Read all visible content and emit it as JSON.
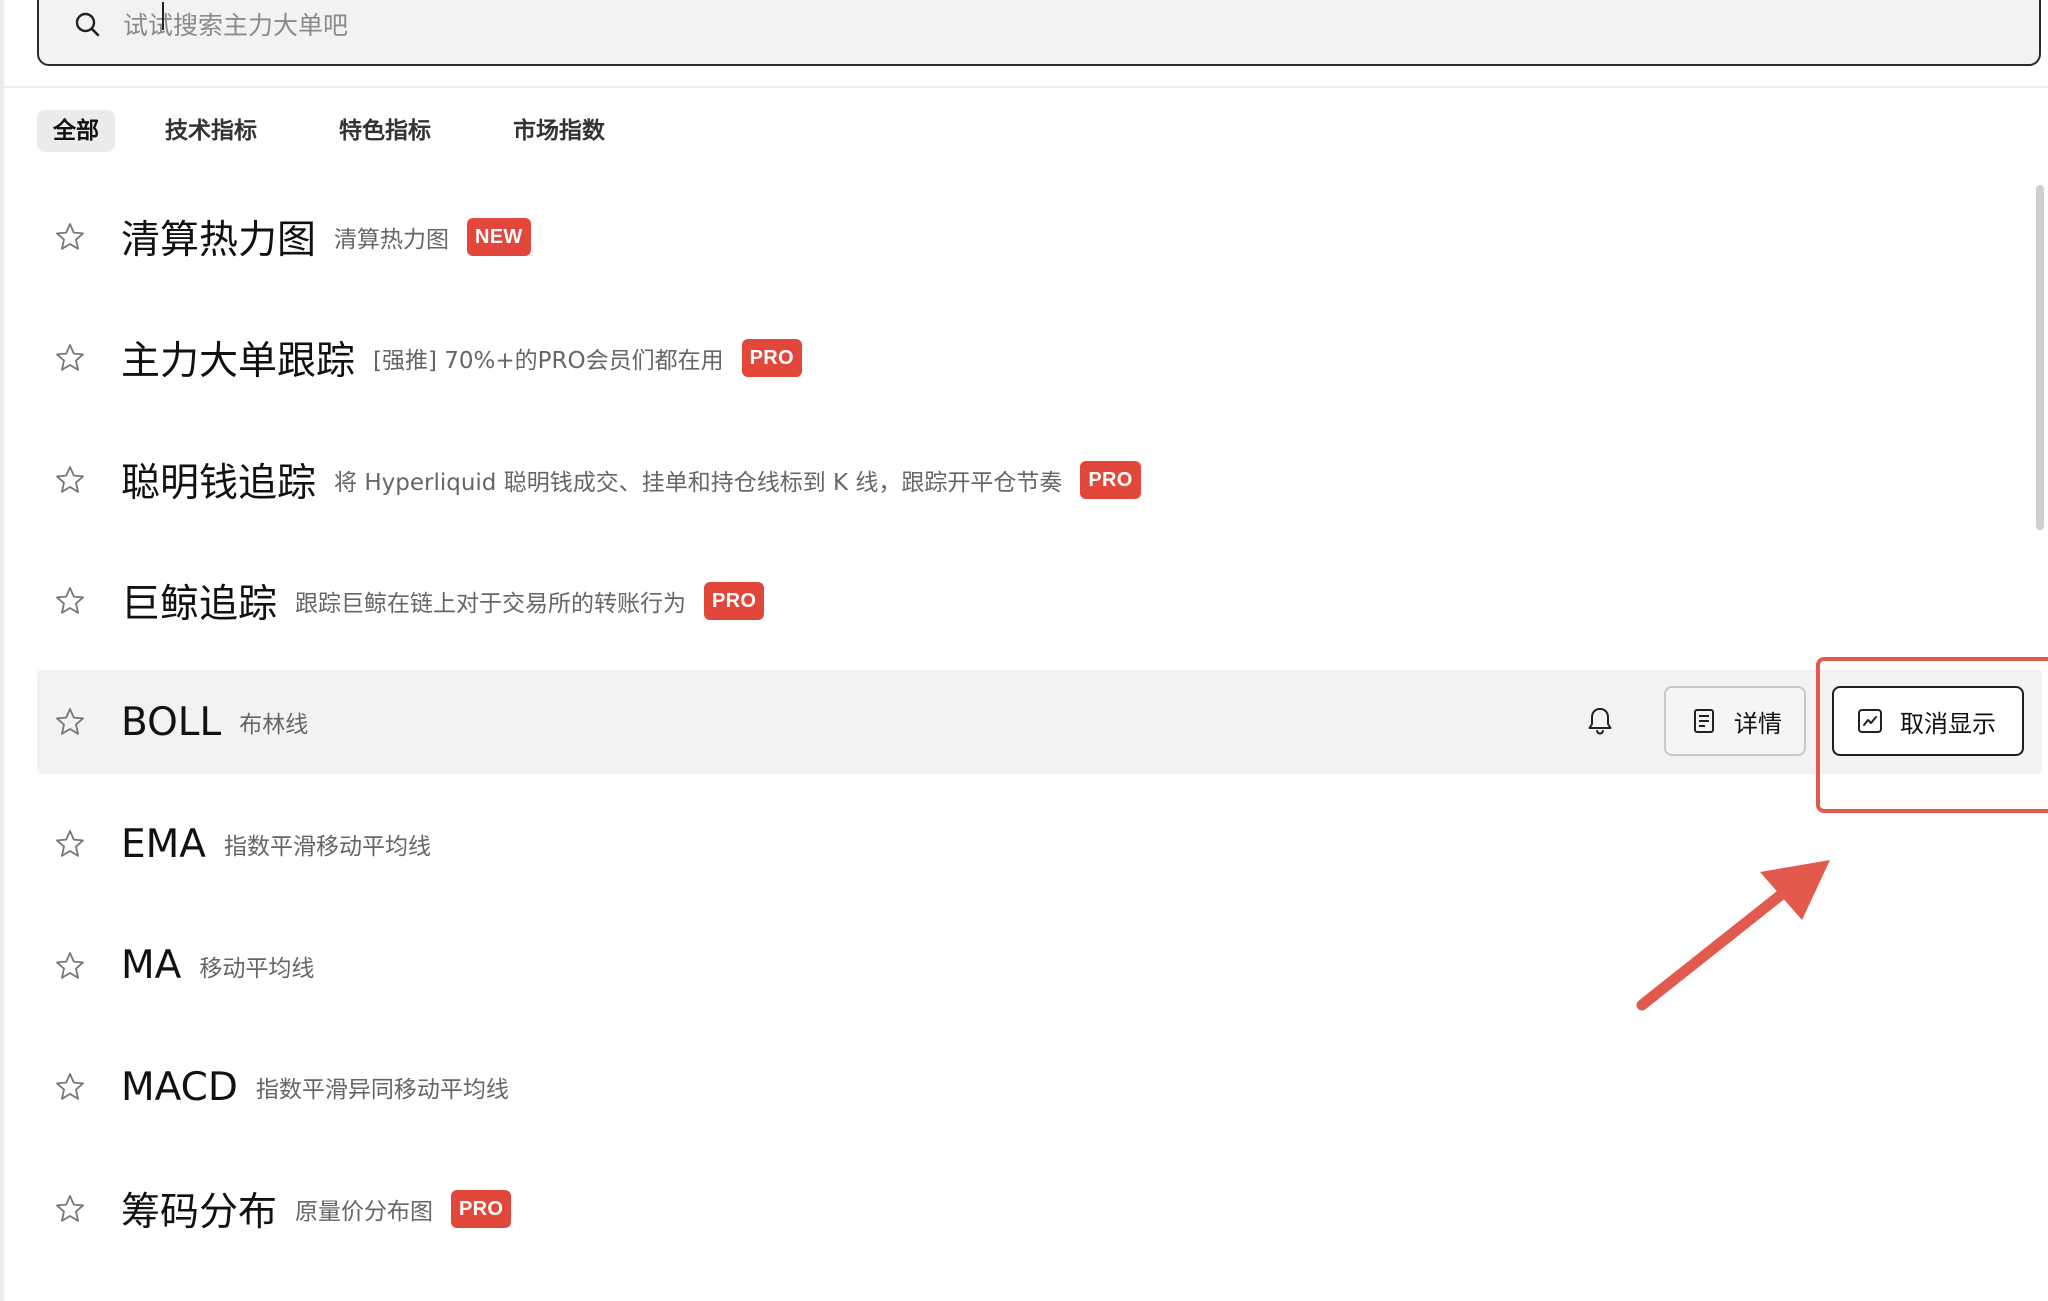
{
  "search": {
    "placeholder": "试试搜索主力大单吧",
    "icon": "search-icon"
  },
  "tabs": [
    {
      "label": "全部",
      "active": true
    },
    {
      "label": "技术指标",
      "active": false
    },
    {
      "label": "特色指标",
      "active": false
    },
    {
      "label": "市场指数",
      "active": false
    }
  ],
  "items": [
    {
      "title": "清算热力图",
      "desc": "清算热力图",
      "badge": "NEW"
    },
    {
      "title": "主力大单跟踪",
      "desc": "[强推] 70%+的PRO会员们都在用",
      "badge": "PRO"
    },
    {
      "title": "聪明钱追踪",
      "desc": "将 Hyperliquid 聪明钱成交、挂单和持仓线标到 K 线，跟踪开平仓节奏",
      "badge": "PRO"
    },
    {
      "title": "巨鲸追踪",
      "desc": "跟踪巨鲸在链上对于交易所的转账行为",
      "badge": "PRO"
    },
    {
      "title": "BOLL",
      "desc": "布林线",
      "badge": ""
    },
    {
      "title": "EMA",
      "desc": "指数平滑移动平均线",
      "badge": ""
    },
    {
      "title": "MA",
      "desc": "移动平均线",
      "badge": ""
    },
    {
      "title": "MACD",
      "desc": "指数平滑异同移动平均线",
      "badge": ""
    },
    {
      "title": "筹码分布",
      "desc": "原量价分布图",
      "badge": "PRO"
    }
  ],
  "actions": {
    "detail_label": "详情",
    "hide_label": "取消显示",
    "bell_icon": "bell-icon",
    "detail_icon": "document-icon",
    "hide_icon": "chart-line-icon"
  },
  "colors": {
    "badge": "#e1473a",
    "annotation": "#e25a4d",
    "highlight_row": "#f2f2f2"
  }
}
